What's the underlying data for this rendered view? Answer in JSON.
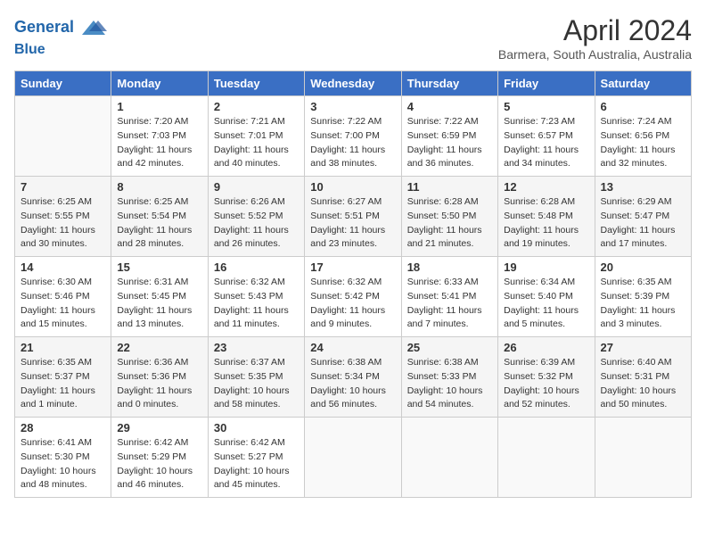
{
  "header": {
    "logo_line1": "General",
    "logo_line2": "Blue",
    "title": "April 2024",
    "subtitle": "Barmera, South Australia, Australia"
  },
  "days_of_week": [
    "Sunday",
    "Monday",
    "Tuesday",
    "Wednesday",
    "Thursday",
    "Friday",
    "Saturday"
  ],
  "weeks": [
    [
      {
        "day": "",
        "info": ""
      },
      {
        "day": "1",
        "info": "Sunrise: 7:20 AM\nSunset: 7:03 PM\nDaylight: 11 hours\nand 42 minutes."
      },
      {
        "day": "2",
        "info": "Sunrise: 7:21 AM\nSunset: 7:01 PM\nDaylight: 11 hours\nand 40 minutes."
      },
      {
        "day": "3",
        "info": "Sunrise: 7:22 AM\nSunset: 7:00 PM\nDaylight: 11 hours\nand 38 minutes."
      },
      {
        "day": "4",
        "info": "Sunrise: 7:22 AM\nSunset: 6:59 PM\nDaylight: 11 hours\nand 36 minutes."
      },
      {
        "day": "5",
        "info": "Sunrise: 7:23 AM\nSunset: 6:57 PM\nDaylight: 11 hours\nand 34 minutes."
      },
      {
        "day": "6",
        "info": "Sunrise: 7:24 AM\nSunset: 6:56 PM\nDaylight: 11 hours\nand 32 minutes."
      }
    ],
    [
      {
        "day": "7",
        "info": "Sunrise: 6:25 AM\nSunset: 5:55 PM\nDaylight: 11 hours\nand 30 minutes."
      },
      {
        "day": "8",
        "info": "Sunrise: 6:25 AM\nSunset: 5:54 PM\nDaylight: 11 hours\nand 28 minutes."
      },
      {
        "day": "9",
        "info": "Sunrise: 6:26 AM\nSunset: 5:52 PM\nDaylight: 11 hours\nand 26 minutes."
      },
      {
        "day": "10",
        "info": "Sunrise: 6:27 AM\nSunset: 5:51 PM\nDaylight: 11 hours\nand 23 minutes."
      },
      {
        "day": "11",
        "info": "Sunrise: 6:28 AM\nSunset: 5:50 PM\nDaylight: 11 hours\nand 21 minutes."
      },
      {
        "day": "12",
        "info": "Sunrise: 6:28 AM\nSunset: 5:48 PM\nDaylight: 11 hours\nand 19 minutes."
      },
      {
        "day": "13",
        "info": "Sunrise: 6:29 AM\nSunset: 5:47 PM\nDaylight: 11 hours\nand 17 minutes."
      }
    ],
    [
      {
        "day": "14",
        "info": "Sunrise: 6:30 AM\nSunset: 5:46 PM\nDaylight: 11 hours\nand 15 minutes."
      },
      {
        "day": "15",
        "info": "Sunrise: 6:31 AM\nSunset: 5:45 PM\nDaylight: 11 hours\nand 13 minutes."
      },
      {
        "day": "16",
        "info": "Sunrise: 6:32 AM\nSunset: 5:43 PM\nDaylight: 11 hours\nand 11 minutes."
      },
      {
        "day": "17",
        "info": "Sunrise: 6:32 AM\nSunset: 5:42 PM\nDaylight: 11 hours\nand 9 minutes."
      },
      {
        "day": "18",
        "info": "Sunrise: 6:33 AM\nSunset: 5:41 PM\nDaylight: 11 hours\nand 7 minutes."
      },
      {
        "day": "19",
        "info": "Sunrise: 6:34 AM\nSunset: 5:40 PM\nDaylight: 11 hours\nand 5 minutes."
      },
      {
        "day": "20",
        "info": "Sunrise: 6:35 AM\nSunset: 5:39 PM\nDaylight: 11 hours\nand 3 minutes."
      }
    ],
    [
      {
        "day": "21",
        "info": "Sunrise: 6:35 AM\nSunset: 5:37 PM\nDaylight: 11 hours\nand 1 minute."
      },
      {
        "day": "22",
        "info": "Sunrise: 6:36 AM\nSunset: 5:36 PM\nDaylight: 11 hours\nand 0 minutes."
      },
      {
        "day": "23",
        "info": "Sunrise: 6:37 AM\nSunset: 5:35 PM\nDaylight: 10 hours\nand 58 minutes."
      },
      {
        "day": "24",
        "info": "Sunrise: 6:38 AM\nSunset: 5:34 PM\nDaylight: 10 hours\nand 56 minutes."
      },
      {
        "day": "25",
        "info": "Sunrise: 6:38 AM\nSunset: 5:33 PM\nDaylight: 10 hours\nand 54 minutes."
      },
      {
        "day": "26",
        "info": "Sunrise: 6:39 AM\nSunset: 5:32 PM\nDaylight: 10 hours\nand 52 minutes."
      },
      {
        "day": "27",
        "info": "Sunrise: 6:40 AM\nSunset: 5:31 PM\nDaylight: 10 hours\nand 50 minutes."
      }
    ],
    [
      {
        "day": "28",
        "info": "Sunrise: 6:41 AM\nSunset: 5:30 PM\nDaylight: 10 hours\nand 48 minutes."
      },
      {
        "day": "29",
        "info": "Sunrise: 6:42 AM\nSunset: 5:29 PM\nDaylight: 10 hours\nand 46 minutes."
      },
      {
        "day": "30",
        "info": "Sunrise: 6:42 AM\nSunset: 5:27 PM\nDaylight: 10 hours\nand 45 minutes."
      },
      {
        "day": "",
        "info": ""
      },
      {
        "day": "",
        "info": ""
      },
      {
        "day": "",
        "info": ""
      },
      {
        "day": "",
        "info": ""
      }
    ]
  ]
}
